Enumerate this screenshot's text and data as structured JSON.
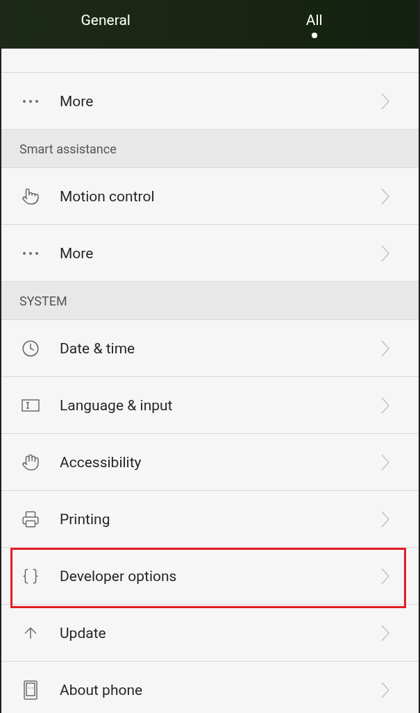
{
  "tabs": [
    {
      "label": "General",
      "selected": false
    },
    {
      "label": "All",
      "selected": true
    }
  ],
  "list": [
    {
      "kind": "row",
      "label": "More",
      "highlighted": false
    },
    {
      "kind": "section",
      "label": "Smart assistance"
    },
    {
      "kind": "row",
      "label": "Motion control",
      "highlighted": false
    },
    {
      "kind": "row",
      "label": "More",
      "highlighted": false
    },
    {
      "kind": "section",
      "label": "SYSTEM"
    },
    {
      "kind": "row",
      "label": "Date & time",
      "highlighted": false
    },
    {
      "kind": "row",
      "label": "Language & input",
      "highlighted": false
    },
    {
      "kind": "row",
      "label": "Accessibility",
      "highlighted": false
    },
    {
      "kind": "row",
      "label": "Printing",
      "highlighted": false
    },
    {
      "kind": "row",
      "label": "Developer options",
      "highlighted": true
    },
    {
      "kind": "row",
      "label": "Update",
      "highlighted": false
    },
    {
      "kind": "row",
      "label": "About phone",
      "highlighted": false
    }
  ]
}
